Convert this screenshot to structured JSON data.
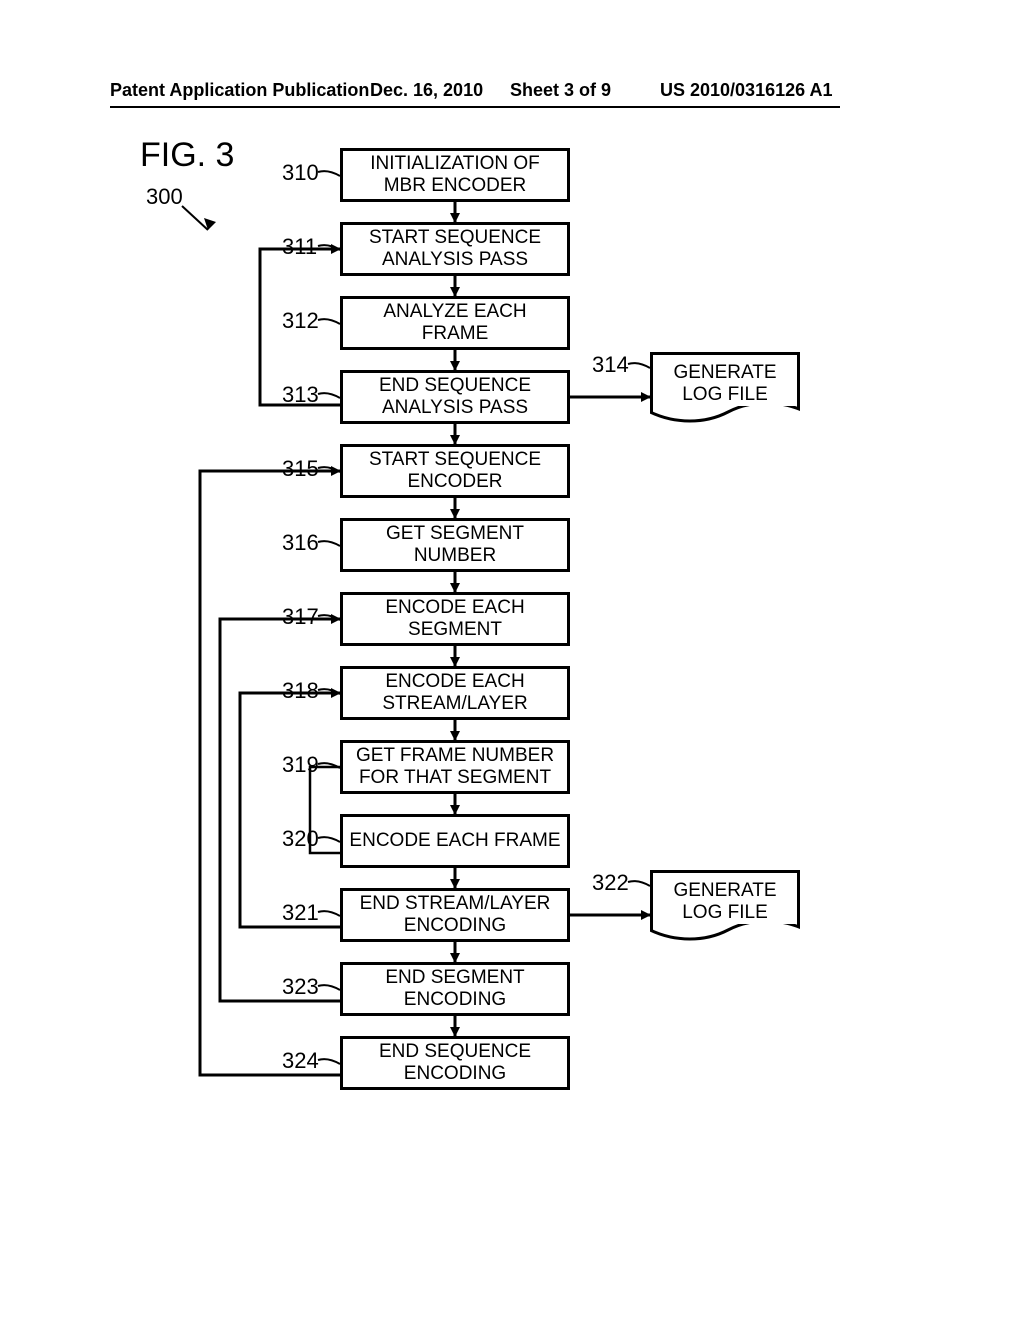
{
  "header": {
    "left": "Patent Application Publication",
    "date": "Dec. 16, 2010",
    "sheet": "Sheet 3 of 9",
    "pubno": "US 2010/0316126 A1"
  },
  "figure": {
    "label": "FIG. 3",
    "ref_main": "300"
  },
  "refs": {
    "r310": "310",
    "r311": "311",
    "r312": "312",
    "r313": "313",
    "r314": "314",
    "r315": "315",
    "r316": "316",
    "r317": "317",
    "r318": "318",
    "r319": "319",
    "r320": "320",
    "r321": "321",
    "r322": "322",
    "r323": "323",
    "r324": "324"
  },
  "boxes": {
    "b310": "INITIALIZATION OF MBR ENCODER",
    "b311": "START SEQUENCE ANALYSIS PASS",
    "b312": "ANALYZE EACH FRAME",
    "b313": "END SEQUENCE ANALYSIS PASS",
    "b314": "GENERATE LOG FILE",
    "b315": "START SEQUENCE ENCODER",
    "b316": "GET SEGMENT NUMBER",
    "b317": "ENCODE EACH SEGMENT",
    "b318": "ENCODE EACH STREAM/LAYER",
    "b319": "GET FRAME NUMBER FOR THAT SEGMENT",
    "b320": "ENCODE EACH FRAME",
    "b321": "END STREAM/LAYER ENCODING",
    "b322": "GENERATE LOG FILE",
    "b323": "END SEGMENT ENCODING",
    "b324": "END SEQUENCE ENCODING"
  },
  "chart_data": {
    "type": "flowchart",
    "title": "FIG. 3",
    "nodes": [
      {
        "id": "310",
        "label": "INITIALIZATION OF MBR ENCODER",
        "shape": "process"
      },
      {
        "id": "311",
        "label": "START SEQUENCE ANALYSIS PASS",
        "shape": "process"
      },
      {
        "id": "312",
        "label": "ANALYZE EACH FRAME",
        "shape": "process"
      },
      {
        "id": "313",
        "label": "END SEQUENCE ANALYSIS PASS",
        "shape": "process"
      },
      {
        "id": "314",
        "label": "GENERATE LOG FILE",
        "shape": "document"
      },
      {
        "id": "315",
        "label": "START SEQUENCE ENCODER",
        "shape": "process"
      },
      {
        "id": "316",
        "label": "GET SEGMENT NUMBER",
        "shape": "process"
      },
      {
        "id": "317",
        "label": "ENCODE EACH SEGMENT",
        "shape": "process"
      },
      {
        "id": "318",
        "label": "ENCODE EACH STREAM/LAYER",
        "shape": "process"
      },
      {
        "id": "319",
        "label": "GET FRAME NUMBER FOR THAT SEGMENT",
        "shape": "process"
      },
      {
        "id": "320",
        "label": "ENCODE EACH FRAME",
        "shape": "process"
      },
      {
        "id": "321",
        "label": "END STREAM/LAYER ENCODING",
        "shape": "process"
      },
      {
        "id": "322",
        "label": "GENERATE LOG FILE",
        "shape": "document"
      },
      {
        "id": "323",
        "label": "END SEGMENT ENCODING",
        "shape": "process"
      },
      {
        "id": "324",
        "label": "END SEQUENCE ENCODING",
        "shape": "process"
      }
    ],
    "edges": [
      {
        "from": "310",
        "to": "311"
      },
      {
        "from": "311",
        "to": "312"
      },
      {
        "from": "312",
        "to": "313"
      },
      {
        "from": "313",
        "to": "314"
      },
      {
        "from": "313",
        "to": "315"
      },
      {
        "from": "313",
        "to": "311",
        "loop": true
      },
      {
        "from": "315",
        "to": "316"
      },
      {
        "from": "316",
        "to": "317"
      },
      {
        "from": "317",
        "to": "318"
      },
      {
        "from": "318",
        "to": "319"
      },
      {
        "from": "319",
        "to": "320"
      },
      {
        "from": "320",
        "to": "321"
      },
      {
        "from": "320",
        "to": "319",
        "loop_inner": true
      },
      {
        "from": "321",
        "to": "322"
      },
      {
        "from": "321",
        "to": "323"
      },
      {
        "from": "321",
        "to": "318",
        "loop": true
      },
      {
        "from": "323",
        "to": "324"
      },
      {
        "from": "323",
        "to": "317",
        "loop": true
      },
      {
        "from": "324",
        "to": "315",
        "loop": true
      }
    ],
    "diagram_ref": "300"
  }
}
